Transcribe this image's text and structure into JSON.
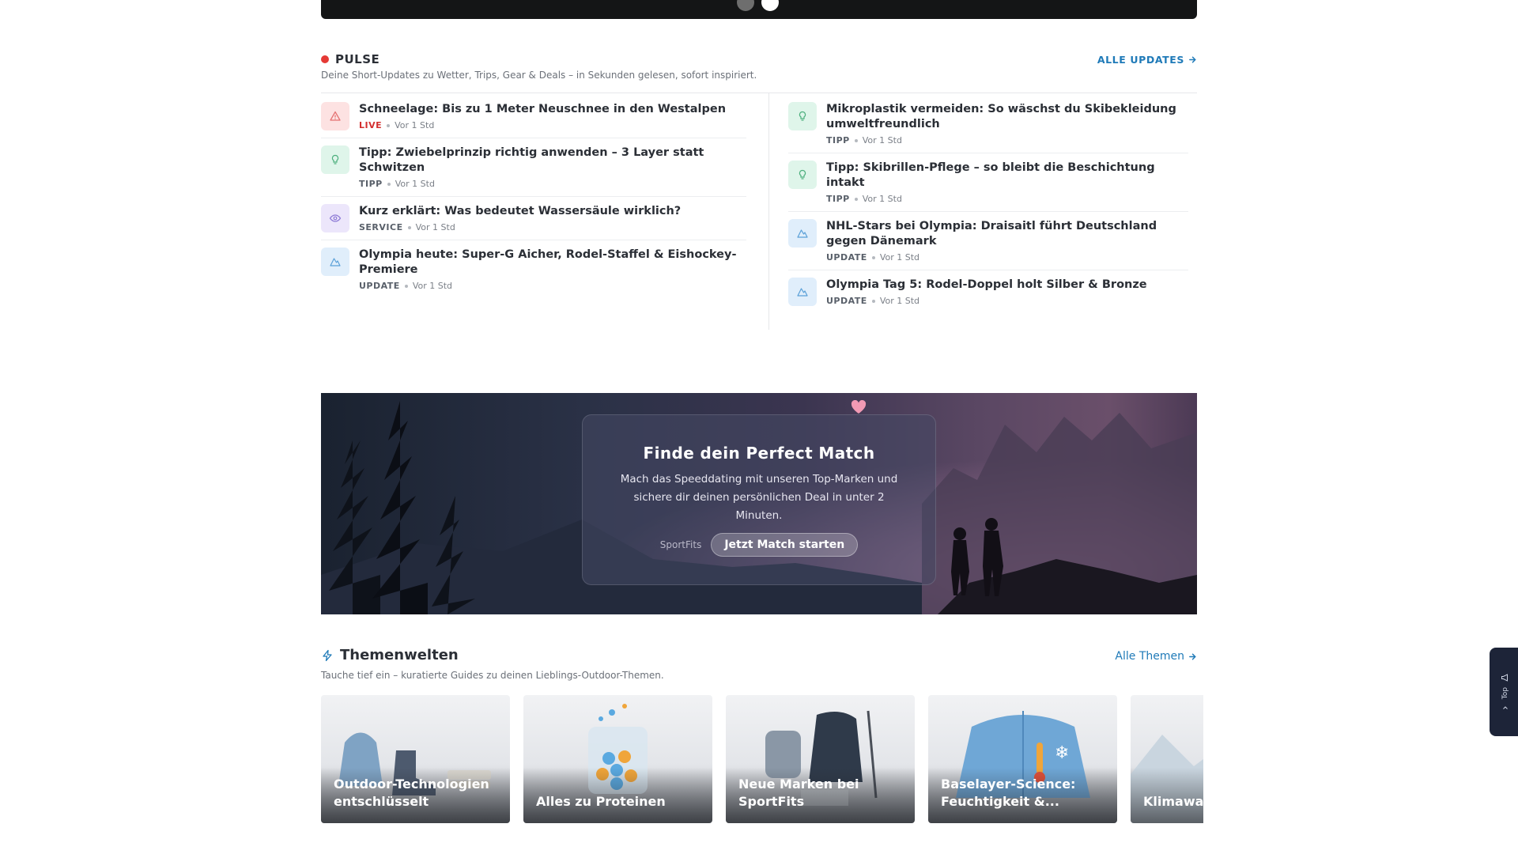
{
  "pulse": {
    "title": "PULSE",
    "subtitle": "Deine Short-Updates zu Wetter, Trips, Gear & Deals – in Sekunden gelesen, sofort inspiriert.",
    "all_link": "ALLE UPDATES",
    "left": [
      {
        "title": "Schneelage: Bis zu 1 Meter Neuschnee in den Westalpen",
        "tag": "LIVE",
        "time": "Vor 1 Std",
        "icon": "warning-icon",
        "tone": "red"
      },
      {
        "title": "Tipp: Zwiebelprinzip richtig anwenden – 3 Layer statt Schwitzen",
        "tag": "TIPP",
        "time": "Vor 1 Std",
        "icon": "lightbulb-icon",
        "tone": "green"
      },
      {
        "title": "Kurz erklärt: Was bedeutet Wassersäule wirklich?",
        "tag": "SERVICE",
        "time": "Vor 1 Std",
        "icon": "eye-icon",
        "tone": "purple"
      },
      {
        "title": "Olympia heute: Super-G Aicher, Rodel-Staffel & Eishockey-Premiere",
        "tag": "UPDATE",
        "time": "Vor 1 Std",
        "icon": "mountain-icon",
        "tone": "blue"
      }
    ],
    "right": [
      {
        "title": "Mikroplastik vermeiden: So wäschst du Skibekleidung umweltfreundlich",
        "tag": "TIPP",
        "time": "Vor 1 Std",
        "icon": "lightbulb-icon",
        "tone": "green"
      },
      {
        "title": "Tipp: Skibrillen-Pflege – so bleibt die Beschichtung intakt",
        "tag": "TIPP",
        "time": "Vor 1 Std",
        "icon": "lightbulb-icon",
        "tone": "green"
      },
      {
        "title": "NHL-Stars bei Olympia: Draisaitl führt Deutschland gegen Dänemark",
        "tag": "UPDATE",
        "time": "Vor 1 Std",
        "icon": "mountain-icon",
        "tone": "blue"
      },
      {
        "title": "Olympia Tag 5: Rodel-Doppel holt Silber & Bronze",
        "tag": "UPDATE",
        "time": "Vor 1 Std",
        "icon": "mountain-icon",
        "tone": "blue"
      }
    ]
  },
  "banner": {
    "title": "Finde dein Perfect Match",
    "text": "Mach das Speeddating mit unseren Top-Marken und sichere dir deinen persönlichen Deal in unter 2 Minuten.",
    "brand": "SportFits",
    "button": "Jetzt Match starten"
  },
  "themen": {
    "title": "Themenwelten",
    "subtitle": "Tauche tief ein – kuratierte Guides zu deinen Lieblings-Outdoor-Themen.",
    "all_link": "Alle Themen",
    "cards": [
      {
        "label": "Outdoor-Technologien entschlüsselt"
      },
      {
        "label": "Alles zu Proteinen"
      },
      {
        "label": "Neue Marken bei SportFits"
      },
      {
        "label": "Baselayer-Science: Feuchtigkeit &..."
      },
      {
        "label": "Klimawa... Bergspo..."
      }
    ]
  },
  "top_button": {
    "label": "Top"
  },
  "colors": {
    "accent": "#1f7ab8",
    "live": "#d32f2f",
    "dark": "#1d2438"
  }
}
